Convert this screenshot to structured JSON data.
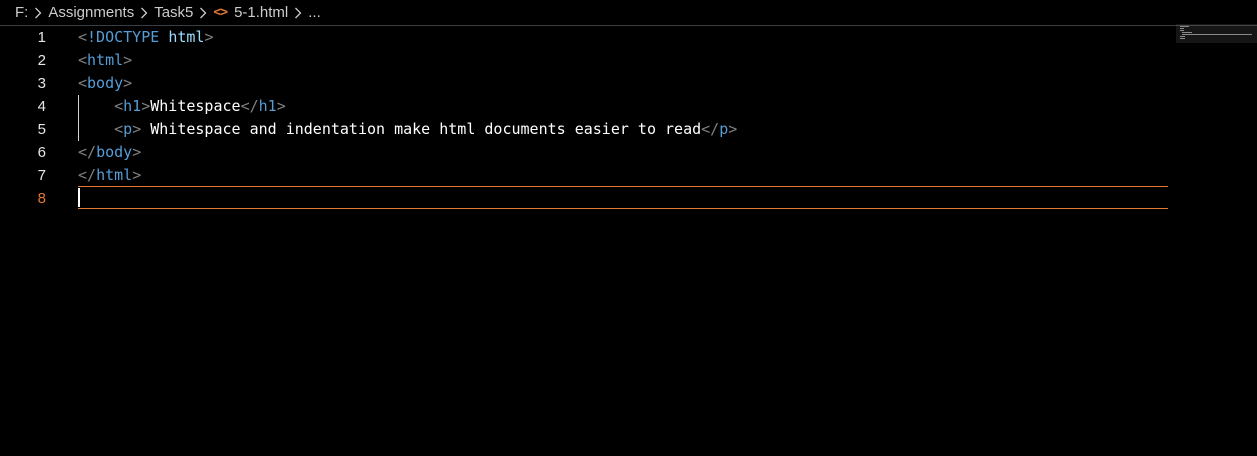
{
  "breadcrumb": {
    "items": [
      "F:",
      "Assignments",
      "Task5",
      "5-1.html",
      "..."
    ],
    "file_icon": "<>"
  },
  "editor": {
    "lines": [
      {
        "number": "1",
        "parts": [
          [
            "tag-p",
            "<"
          ],
          [
            "kw",
            "!DOCTYPE"
          ],
          [
            "txt",
            " "
          ],
          [
            "attr",
            "html"
          ],
          [
            "tag-p",
            ">"
          ]
        ]
      },
      {
        "number": "2",
        "parts": [
          [
            "tag-p",
            "<"
          ],
          [
            "tag-n",
            "html"
          ],
          [
            "tag-p",
            ">"
          ]
        ]
      },
      {
        "number": "3",
        "parts": [
          [
            "tag-p",
            "<"
          ],
          [
            "tag-n",
            "body"
          ],
          [
            "tag-p",
            ">"
          ]
        ]
      },
      {
        "number": "4",
        "parts": [
          [
            "txt",
            "    "
          ],
          [
            "tag-p",
            "<"
          ],
          [
            "tag-n",
            "h1"
          ],
          [
            "tag-p",
            ">"
          ],
          [
            "txt",
            "Whitespace"
          ],
          [
            "tag-p",
            "</"
          ],
          [
            "tag-n",
            "h1"
          ],
          [
            "tag-p",
            ">"
          ]
        ]
      },
      {
        "number": "5",
        "parts": [
          [
            "txt",
            "    "
          ],
          [
            "tag-p",
            "<"
          ],
          [
            "tag-n",
            "p"
          ],
          [
            "tag-p",
            ">"
          ],
          [
            "txt",
            " Whitespace and indentation make html documents easier to read"
          ],
          [
            "tag-p",
            "</"
          ],
          [
            "tag-n",
            "p"
          ],
          [
            "tag-p",
            ">"
          ]
        ]
      },
      {
        "number": "6",
        "parts": [
          [
            "tag-p",
            "</"
          ],
          [
            "tag-n",
            "body"
          ],
          [
            "tag-p",
            ">"
          ]
        ]
      },
      {
        "number": "7",
        "parts": [
          [
            "tag-p",
            "</"
          ],
          [
            "tag-n",
            "html"
          ],
          [
            "tag-p",
            ">"
          ]
        ]
      },
      {
        "number": "8",
        "parts": []
      }
    ],
    "active_line": "8"
  },
  "colors": {
    "background": "#000000",
    "accent": "#e37933",
    "tag_name": "#569cd6",
    "tag_punct": "#808080",
    "text": "#ffffff"
  },
  "icons": [
    "chevron-right-icon",
    "html-file-icon"
  ]
}
